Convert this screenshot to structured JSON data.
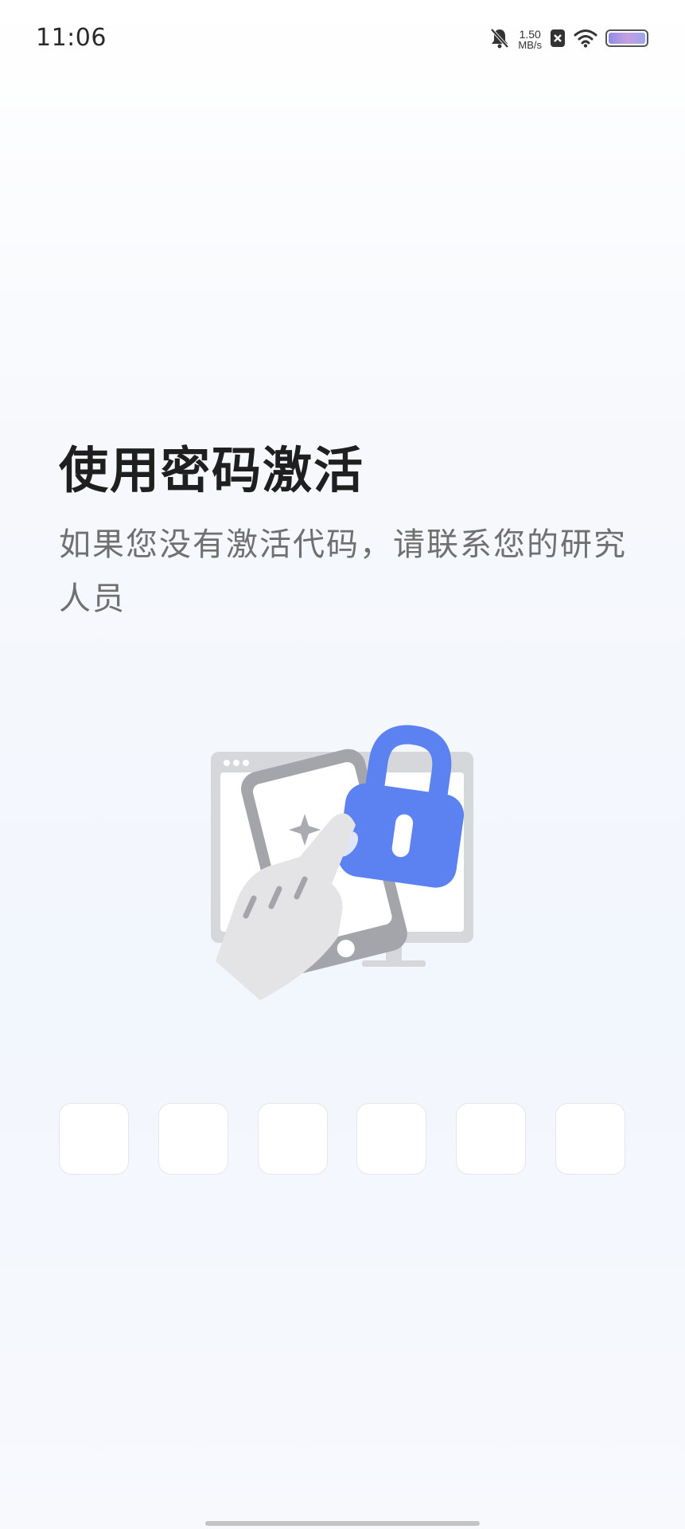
{
  "status_bar": {
    "time": "11:06",
    "net_speed_value": "1.50",
    "net_speed_unit": "MB/s",
    "icons": [
      "bell-muted-icon",
      "sim-off-icon",
      "wifi-icon",
      "battery-icon"
    ]
  },
  "main": {
    "title": "使用密码激活",
    "subtitle": "如果您没有激活代码，请联系您的研究人员",
    "illustration_icon": "phone-lock-activation-illustration"
  },
  "code_input": {
    "box_count": 6,
    "values": [
      "",
      "",
      "",
      "",
      "",
      ""
    ]
  },
  "colors": {
    "accent": "#5b82f0",
    "title_text": "#1f1f1f",
    "subtitle_text": "#707070",
    "box_border": "#e6e6ea"
  }
}
